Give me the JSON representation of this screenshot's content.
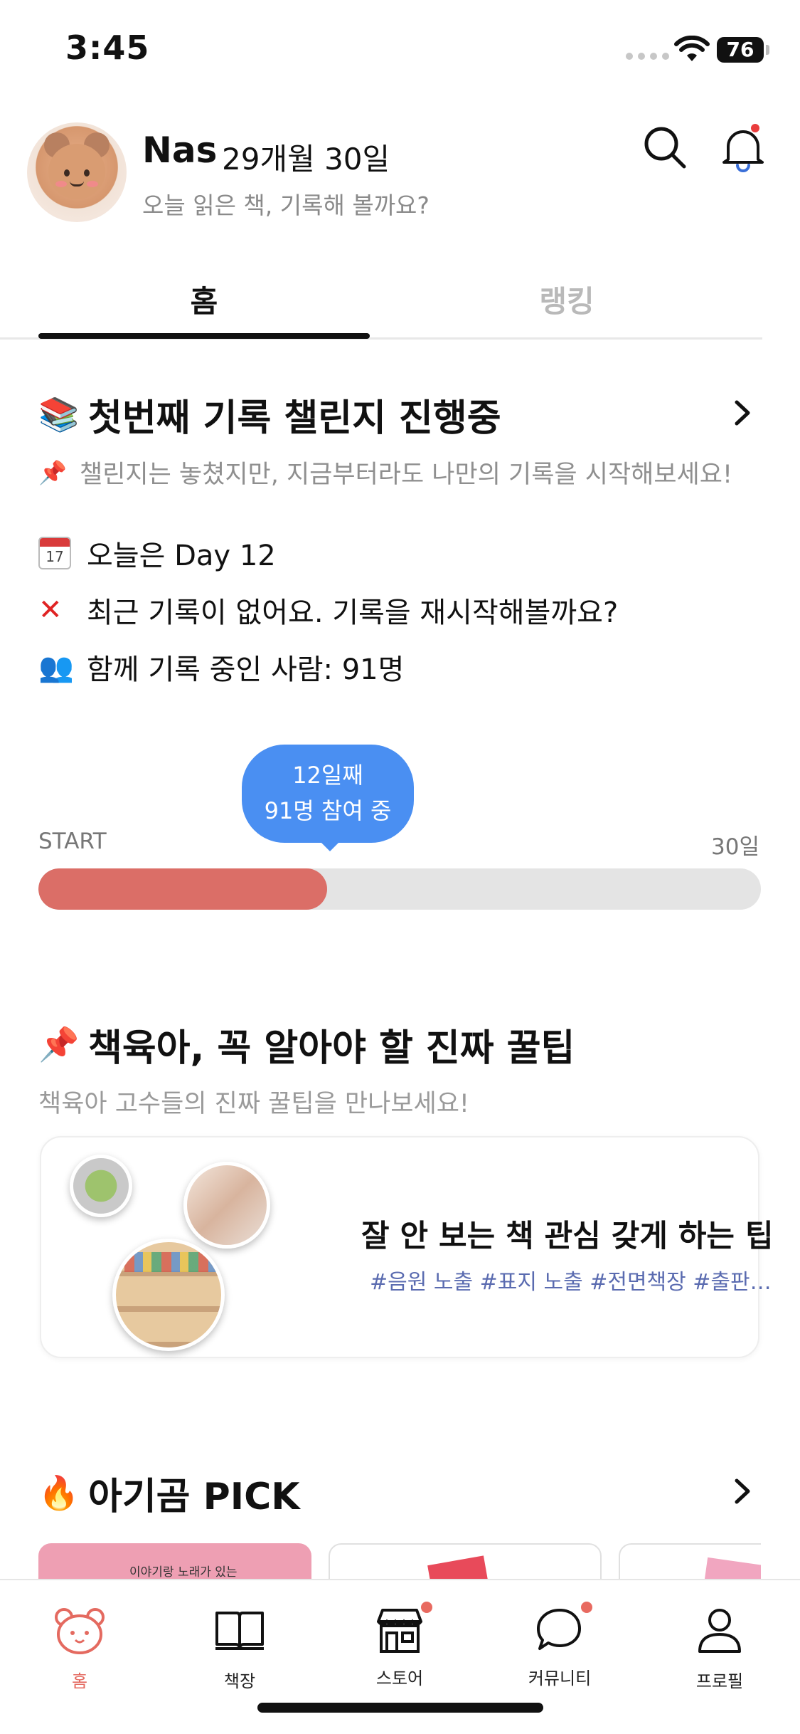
{
  "status_bar": {
    "time": "3:45",
    "battery": "76"
  },
  "header": {
    "user_name": "Nas",
    "user_date": "29개월 30일",
    "subtitle": "오늘 읽은 책, 기록해 볼까요?"
  },
  "tabs": [
    {
      "label": "홈",
      "active": true
    },
    {
      "label": "랭킹",
      "active": false
    }
  ],
  "challenge": {
    "title_emoji": "📚",
    "title": "첫번째 기록 챌린지 진행중",
    "note_emoji": "📌",
    "note": "챌린지는 놓쳤지만, 지금부터라도 나만의 기록을 시작해보세요!",
    "calendar_day": "17",
    "day_text": "오늘은 Day 12",
    "warn_text": "최근 기록이 없어요. 기록을 재시작해볼까요?",
    "people_emoji": "👥",
    "people_text": "함께 기록 중인 사람: 91명",
    "bubble_day": "12일째",
    "bubble_people": "91명 참여 중",
    "progress_start": "START",
    "progress_end": "30일",
    "progress_value": 12,
    "progress_max": 30
  },
  "tips": {
    "title_emoji": "📌",
    "title": "책육아, 꼭 알아야 할 진짜 꿀팁",
    "subtitle": "책육아 고수들의 진짜 꿀팁을 만나보세요!",
    "card_heading": "잘 안 보는 책 관심 갖게 하는 팁",
    "card_tags": "#음원 노출 #표지 노출 #전면책장 #출판사 교육 ..."
  },
  "pick": {
    "title_emoji": "🔥",
    "title": "아기곰 PICK",
    "card1_text": "이야기랑 노래가 있는"
  },
  "bottom_nav": {
    "home": "홈",
    "shelf": "책장",
    "store": "스토어",
    "community": "커뮤니티",
    "profile": "프로필"
  },
  "colors": {
    "accent_red": "#db6e67",
    "bubble_blue": "#4a8ff2",
    "tag_blue": "#5a6bb0",
    "notification_red": "#ea3d3d"
  }
}
